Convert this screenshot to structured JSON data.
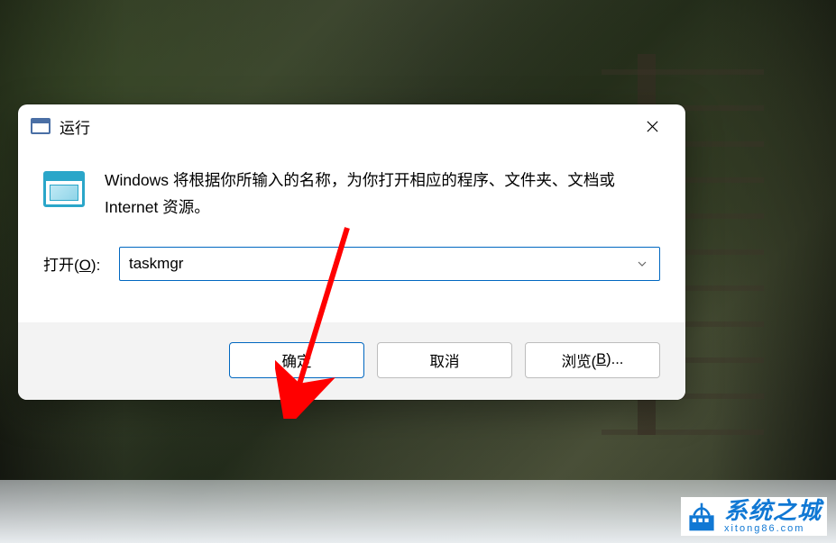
{
  "dialog": {
    "title": "运行",
    "description": "Windows 将根据你所输入的名称，为你打开相应的程序、文件夹、文档或 Internet 资源。",
    "open_label_prefix": "打开(",
    "open_label_key": "O",
    "open_label_suffix": "):",
    "input_value": "taskmgr",
    "buttons": {
      "ok": "确定",
      "cancel": "取消",
      "browse_prefix": "浏览(",
      "browse_key": "B",
      "browse_suffix": ")..."
    }
  },
  "watermark": {
    "main": "系统之城",
    "sub": "xitong86.com"
  }
}
